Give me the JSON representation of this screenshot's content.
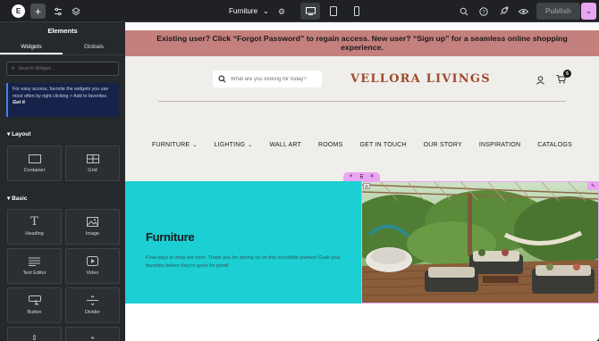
{
  "topbar": {
    "logo": "E",
    "add": "+",
    "page_name": "Furniture",
    "publish_label": "Publish"
  },
  "panel": {
    "title": "Elements",
    "tabs": [
      "Widgets",
      "Globals"
    ],
    "search_placeholder": "Search Widget...",
    "tip_text": "For easy access, favorite the widgets you use most often by right clicking > Add to favorites.",
    "tip_link": "Got it",
    "sections": {
      "layout": "Layout",
      "basic": "Basic"
    },
    "layout_widgets": [
      {
        "label": "Container",
        "icon": "container-icon"
      },
      {
        "label": "Grid",
        "icon": "grid-icon"
      }
    ],
    "basic_widgets": [
      {
        "label": "Heading",
        "icon": "heading-icon"
      },
      {
        "label": "Image",
        "icon": "image-icon"
      },
      {
        "label": "Text Editor",
        "icon": "text-editor-icon"
      },
      {
        "label": "Video",
        "icon": "video-icon"
      },
      {
        "label": "Button",
        "icon": "button-icon"
      },
      {
        "label": "Divider",
        "icon": "divider-icon"
      }
    ]
  },
  "site": {
    "banner": "Existing user? Click “Forgot Password” to regain access. New user? “Sign up” for a seamless online shopping experience.",
    "search_placeholder": "What are you looking for today?",
    "brand": "VELLORA  LIVINGS",
    "cart_count": "5",
    "nav": [
      {
        "label": "FURNITURE",
        "dropdown": true
      },
      {
        "label": "LIGHTING",
        "dropdown": true
      },
      {
        "label": "WALL ART",
        "dropdown": false
      },
      {
        "label": "ROOMS",
        "dropdown": false
      },
      {
        "label": "GET IN TOUCH",
        "dropdown": false
      },
      {
        "label": "OUR STORY",
        "dropdown": false
      },
      {
        "label": "INSPIRATION",
        "dropdown": false
      },
      {
        "label": "CATALOGS",
        "dropdown": false
      }
    ],
    "hero_title": "Furniture",
    "hero_text": "Final days to shop are here. Thank you for joining us on this incredible journey! Grab your favorites before they're gone for good!"
  },
  "colors": {
    "banner": "#c4807d",
    "brand": "#a04a2c",
    "hero_bg": "#1bcfd3",
    "accent": "#e8a5f0"
  }
}
